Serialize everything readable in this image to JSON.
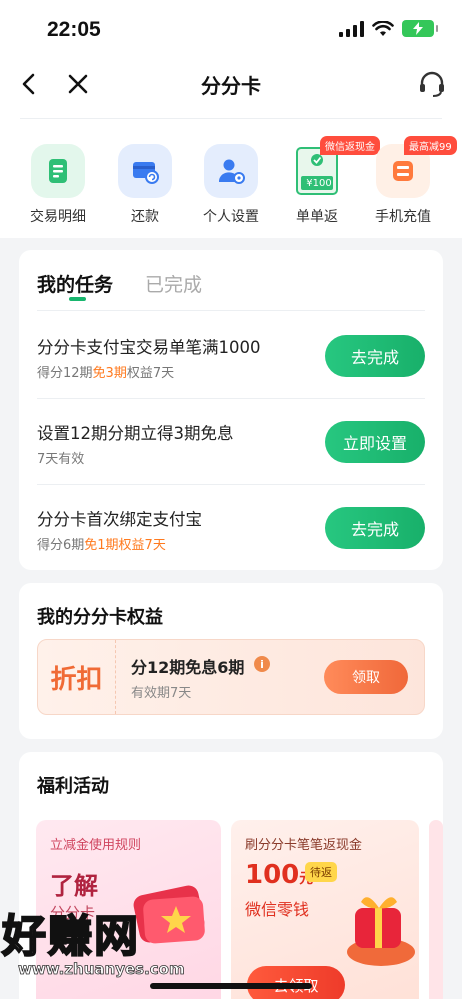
{
  "status": {
    "time": "22:05"
  },
  "nav": {
    "title": "分分卡"
  },
  "quick_actions": [
    {
      "label": "交易明细",
      "icon": "transaction-detail-icon",
      "color": "#2fbf76"
    },
    {
      "label": "还款",
      "icon": "repay-icon",
      "color": "#3a7bf0"
    },
    {
      "label": "个人设置",
      "icon": "user-settings-icon",
      "color": "#3a7bf0"
    },
    {
      "label": "单单返",
      "icon": "cashback-card-icon",
      "badge": "微信返现金",
      "card_text": "¥100"
    },
    {
      "label": "手机充值",
      "icon": "phone-recharge-icon",
      "badge": "最高减99"
    }
  ],
  "tasks_card": {
    "tab_active": "我的任务",
    "tab_inactive": "已完成",
    "tasks": [
      {
        "title": "分分卡支付宝交易单笔满1000",
        "desc_pre": "得分12期",
        "desc_hl": "免3期",
        "desc_post": "权益7天",
        "button": "去完成"
      },
      {
        "title": "设置12期分期立得3期免息",
        "desc_pre": "7天有效",
        "desc_hl": "",
        "desc_post": "",
        "button": "立即设置"
      },
      {
        "title": "分分卡首次绑定支付宝",
        "desc_pre": "得分6期",
        "desc_hl": "免1期权益7天",
        "desc_post": "",
        "button": "去完成"
      }
    ]
  },
  "benefits_card": {
    "title": "我的分分卡权益",
    "tag": "折扣",
    "name": "分12期免息6期",
    "valid": "有效期7天",
    "button": "领取"
  },
  "welfare_card": {
    "title": "福利活动",
    "promo1": {
      "sub": "立减金使用规则",
      "big": "了解",
      "small": "分分卡"
    },
    "promo2": {
      "sub": "刷分分卡笔笔返现金",
      "amount": "100",
      "unit": "元",
      "tag": "待返",
      "desc": "微信零钱",
      "button": "去领取"
    }
  },
  "watermark": {
    "text": "好赚网",
    "url": "www.zhuanyes.com"
  },
  "colors": {
    "brand_green": "#18b66e",
    "accent_orange": "#ff7a1f"
  }
}
